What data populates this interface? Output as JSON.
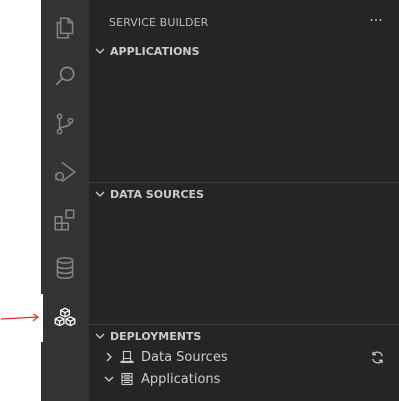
{
  "sidebar": {
    "title": "SERVICE BUILDER",
    "more_label": "···",
    "sections": {
      "applications": {
        "label": "APPLICATIONS",
        "expanded": true
      },
      "data_sources": {
        "label": "DATA SOURCES",
        "expanded": true
      },
      "deployments": {
        "label": "DEPLOYMENTS",
        "expanded": true,
        "items": [
          {
            "label": "Data Sources",
            "icon": "laptop-icon",
            "expanded": false
          },
          {
            "label": "Applications",
            "icon": "server-icon",
            "expanded": true
          }
        ]
      }
    }
  },
  "activity_bar": {
    "items": [
      "explorer-icon",
      "search-icon",
      "source-control-icon",
      "run-debug-icon",
      "extensions-icon",
      "database-icon",
      "service-builder-icon"
    ]
  },
  "colors": {
    "activity_bar_bg": "#333333",
    "sidebar_bg": "#252526",
    "icon_inactive": "#858585",
    "icon_active": "#ffffff",
    "text": "#cccccc",
    "annotation_arrow": "#e03030"
  }
}
